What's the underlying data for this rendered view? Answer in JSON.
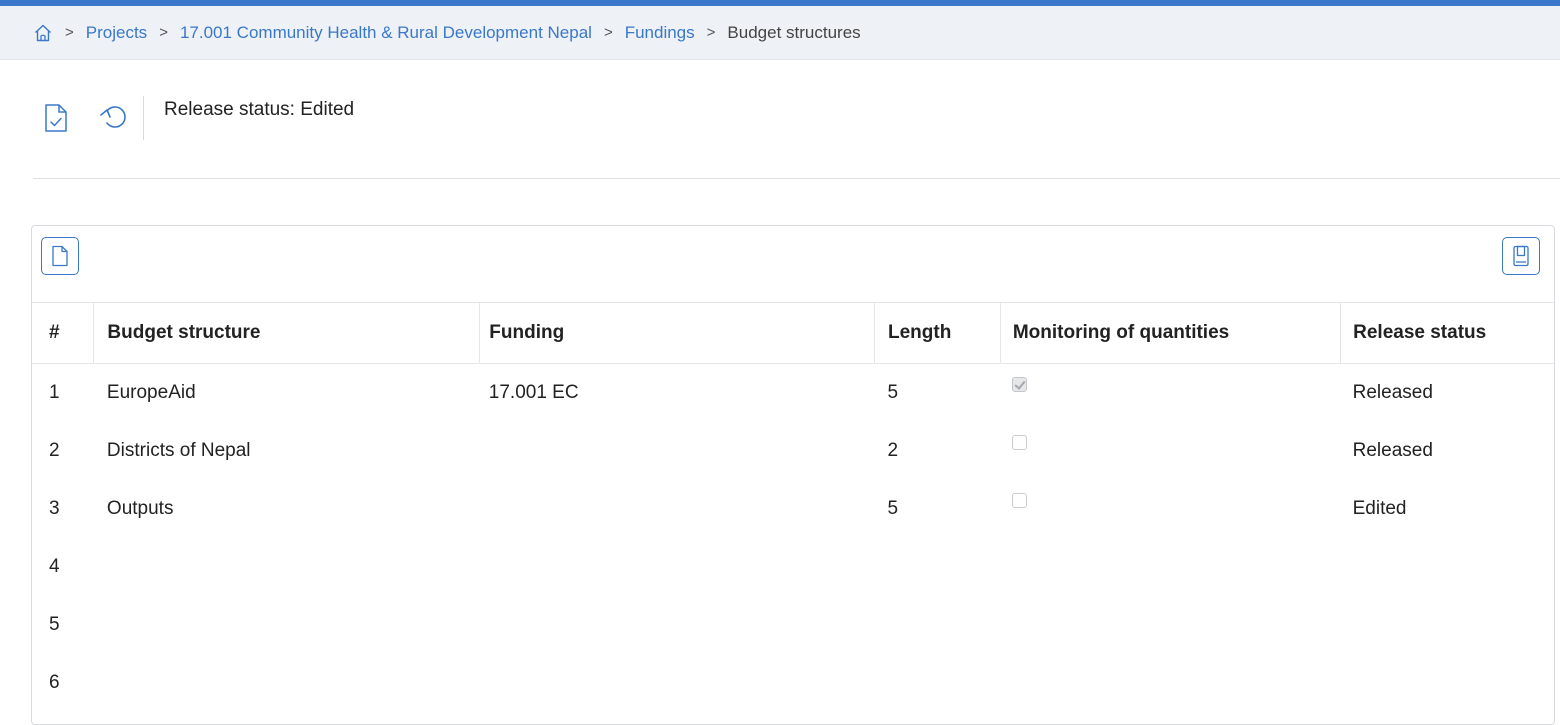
{
  "breadcrumb": {
    "home_icon": "home-icon",
    "separator": ">",
    "items": [
      {
        "label": "Projects"
      },
      {
        "label": "17.001 Community Health & Rural Development Nepal"
      },
      {
        "label": "Fundings"
      }
    ],
    "current": "Budget structures"
  },
  "toolbar": {
    "release_icon": "document-check-icon",
    "undo_icon": "undo-icon",
    "release_status_text": "Release status: Edited"
  },
  "panel": {
    "new_icon": "new-document-icon",
    "save_icon": "save-icon"
  },
  "table": {
    "headers": {
      "num": "#",
      "budget_structure": "Budget structure",
      "funding": "Funding",
      "length": "Length",
      "monitoring": "Monitoring of quantities",
      "release_status": "Release status"
    },
    "rows": [
      {
        "num": "1",
        "budget_structure": "EuropeAid",
        "funding": "17.001 EC",
        "length": "5",
        "monitoring": true,
        "release_status": "Released"
      },
      {
        "num": "2",
        "budget_structure": "Districts of Nepal",
        "funding": "",
        "length": "2",
        "monitoring": false,
        "release_status": "Released"
      },
      {
        "num": "3",
        "budget_structure": "Outputs",
        "funding": "",
        "length": "5",
        "monitoring": false,
        "release_status": "Edited"
      },
      {
        "num": "4",
        "budget_structure": "",
        "funding": "",
        "length": "",
        "monitoring": null,
        "release_status": ""
      },
      {
        "num": "5",
        "budget_structure": "",
        "funding": "",
        "length": "",
        "monitoring": null,
        "release_status": ""
      },
      {
        "num": "6",
        "budget_structure": "",
        "funding": "",
        "length": "",
        "monitoring": null,
        "release_status": ""
      }
    ]
  },
  "colors": {
    "accent": "#3a78c9",
    "breadcrumb_bg": "#eef1f5",
    "border": "#d7dbe0"
  }
}
